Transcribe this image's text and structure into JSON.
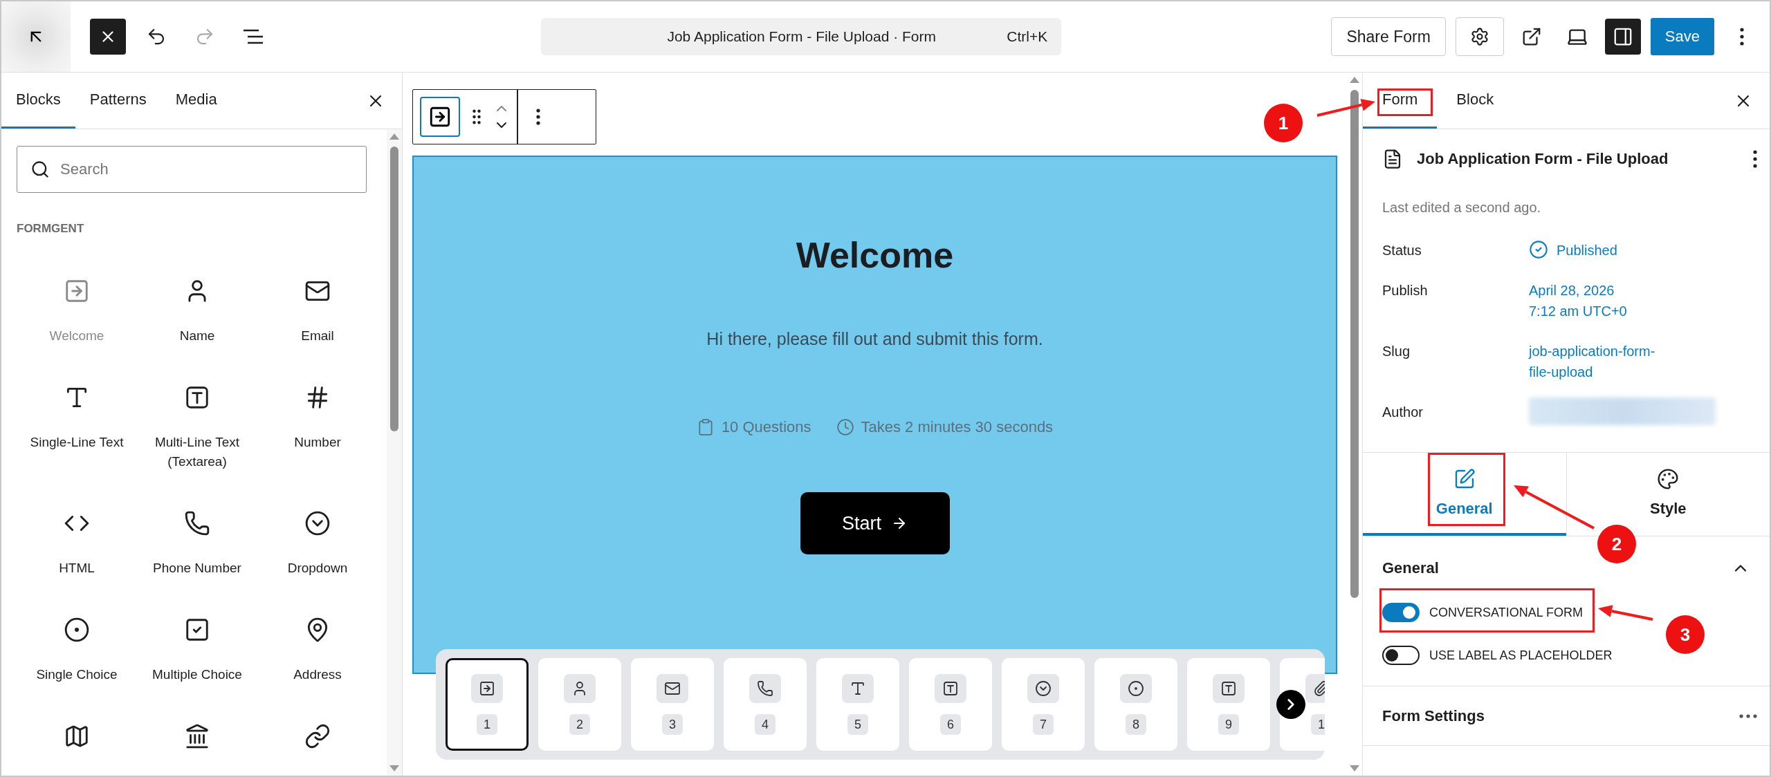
{
  "top_bar": {
    "undo": {
      "disabled": false
    },
    "redo": {
      "disabled": true
    },
    "command_title": "Job Application Form - File Upload · Form",
    "shortcut": "Ctrl+K",
    "share_button": "Share Form",
    "sidebar_toggle": {
      "on": true
    },
    "save_button": "Save"
  },
  "inserter": {
    "tabs": [
      {
        "label": "Blocks",
        "selected": true
      },
      {
        "label": "Patterns",
        "selected": false
      },
      {
        "label": "Media",
        "selected": false
      }
    ],
    "search": {
      "placeholder": "Search"
    },
    "category": "FORMGENT",
    "blocks": [
      {
        "label": "Welcome",
        "disabled": true
      },
      {
        "label": "Name",
        "disabled": false
      },
      {
        "label": "Email",
        "disabled": false
      },
      {
        "label": "Single-Line Text",
        "disabled": false
      },
      {
        "label": "Multi-Line Text (Textarea)",
        "disabled": false
      },
      {
        "label": "Number",
        "disabled": false
      },
      {
        "label": "HTML",
        "disabled": false
      },
      {
        "label": "Phone Number",
        "disabled": false
      },
      {
        "label": "Dropdown",
        "disabled": false
      },
      {
        "label": "Single Choice",
        "disabled": false
      },
      {
        "label": "Multiple Choice",
        "disabled": false
      },
      {
        "label": "Address",
        "disabled": false
      },
      {
        "cut_off": true
      },
      {
        "cut_off": true
      },
      {
        "cut_off": true
      }
    ]
  },
  "canvas": {
    "title": "Welcome",
    "subtitle": "Hi there, please fill out and submit this form.",
    "questions": "10 Questions",
    "duration": "Takes 2 minutes 30 seconds",
    "start_button": "Start",
    "steps": [
      {
        "number": "1",
        "selected": true
      },
      {
        "number": "2",
        "selected": false
      },
      {
        "number": "3",
        "selected": false
      },
      {
        "number": "4",
        "selected": false
      },
      {
        "number": "5",
        "selected": false
      },
      {
        "number": "6",
        "selected": false
      },
      {
        "number": "7",
        "selected": false
      },
      {
        "number": "8",
        "selected": false
      },
      {
        "number": "9",
        "selected": false
      },
      {
        "number": "1",
        "selected": false
      }
    ]
  },
  "settings": {
    "tabs": [
      {
        "label": "Form",
        "selected": true
      },
      {
        "label": "Block",
        "selected": false
      }
    ],
    "form_title": "Job Application Form - File Upload",
    "last_edited": "Last edited a second ago.",
    "fields": [
      {
        "label": "Status",
        "kind": "status",
        "lines": [
          "Published"
        ]
      },
      {
        "label": "Publish",
        "kind": "link",
        "lines": [
          "April 28, 2026",
          "7:12 am UTC+0"
        ]
      },
      {
        "label": "Slug",
        "kind": "link",
        "lines": [
          "job-application-form-",
          "file-upload"
        ]
      },
      {
        "label": "Author",
        "kind": "redacted"
      }
    ],
    "panel_tabs": [
      {
        "label": "General",
        "selected": true
      },
      {
        "label": "Style",
        "selected": false
      }
    ],
    "section": {
      "title": "General",
      "expanded": true,
      "toggles": [
        {
          "label": "CONVERSATIONAL FORM",
          "on": true
        },
        {
          "label": "USE LABEL AS PLACEHOLDER",
          "on": false
        }
      ]
    },
    "form_settings": "Form Settings"
  },
  "annotations": [
    {
      "number": "1"
    },
    {
      "number": "2"
    },
    {
      "number": "3"
    }
  ]
}
